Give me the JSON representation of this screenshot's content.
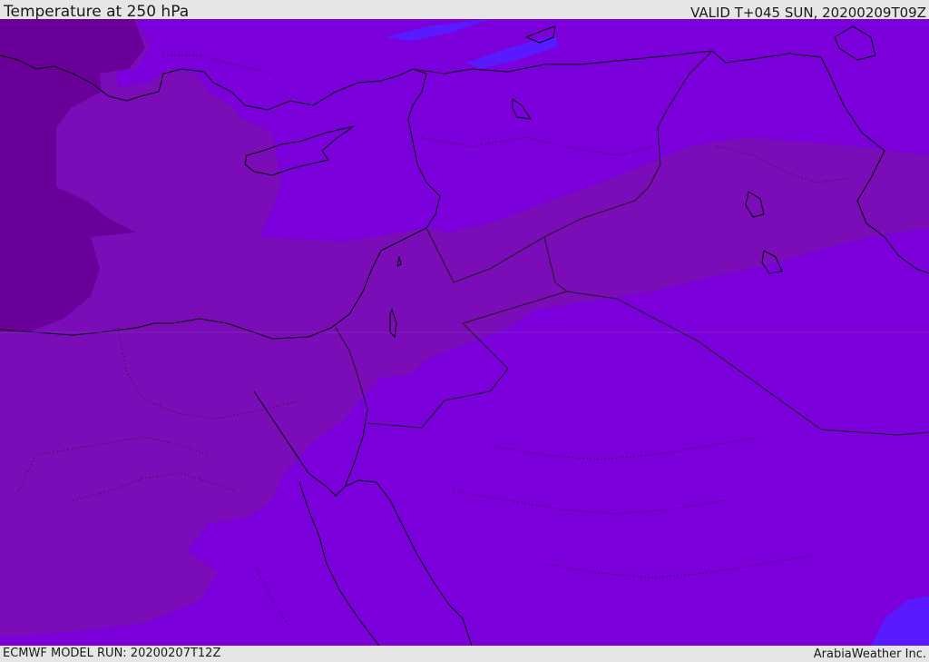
{
  "header": {
    "title": "Temperature at 250 hPa",
    "valid_time": "VALID T+045 SUN, 20200209T09Z"
  },
  "footer": {
    "model_run": "ECMWF MODEL RUN: 20200207T12Z",
    "credit": "ArabiaWeather Inc."
  },
  "map": {
    "variable": "temperature",
    "level": "250 hPa",
    "colors": {
      "base_band": "#7b00dc",
      "warm_band": "#7a0db8",
      "warmest_band": "#6a0099",
      "cool_patch": "#5a1aff",
      "coastline": "#000000",
      "border": "#1a1a1a"
    }
  }
}
